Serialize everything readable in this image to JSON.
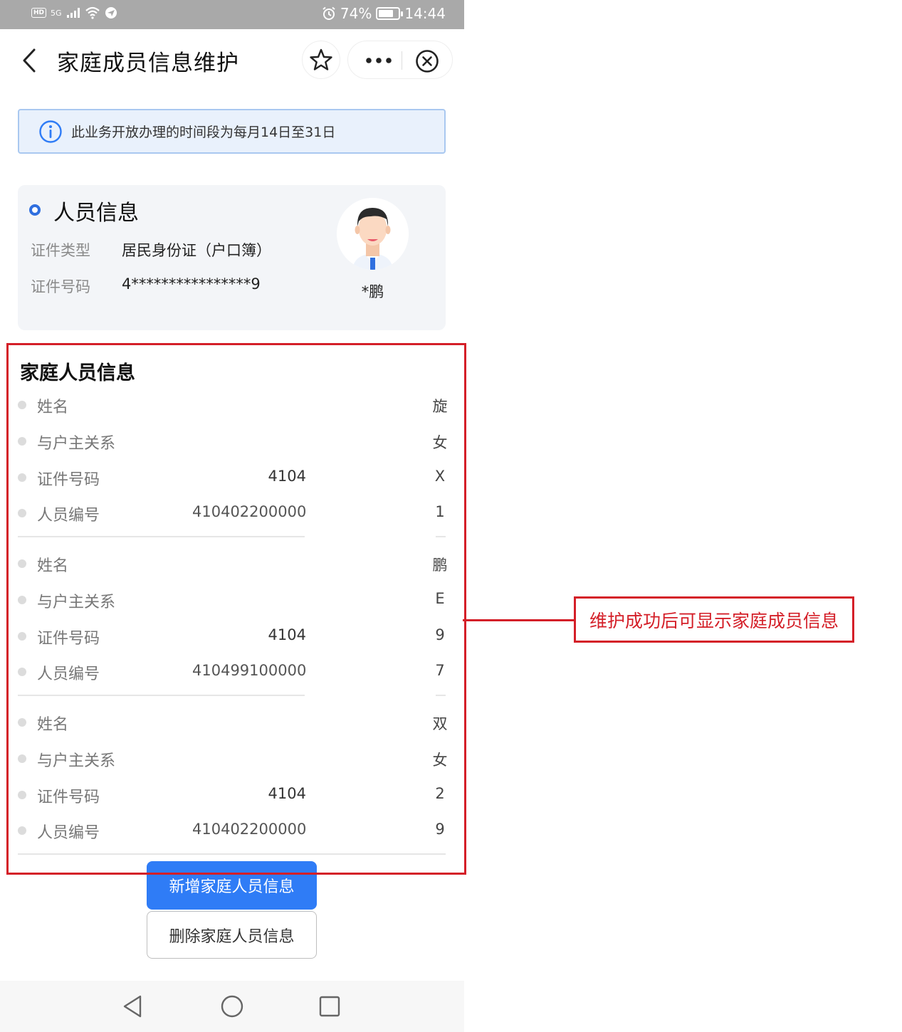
{
  "status_bar": {
    "network": "HD",
    "signal": "5G",
    "battery_text": "74%",
    "battery_level": 0.74,
    "time": "14:44"
  },
  "header": {
    "title": "家庭成员信息维护"
  },
  "notice": {
    "text": "此业务开放办理的时间段为每月14日至31日"
  },
  "person": {
    "section_title": "人员信息",
    "id_type_label": "证件类型",
    "id_type_value": "居民身份证（户口簿）",
    "id_number_label": "证件号码",
    "id_number_value": "4****************9",
    "name": "*鹏"
  },
  "family": {
    "section_title": "家庭人员信息",
    "members": [
      {
        "rows": [
          {
            "label": "姓名",
            "value": "",
            "tail": "旋"
          },
          {
            "label": "与户主关系",
            "value": "",
            "tail": "女"
          },
          {
            "label": "证件号码",
            "value": "4104",
            "tail": "X"
          },
          {
            "label": "人员编号",
            "value": "410402200000",
            "tail": "1"
          }
        ]
      },
      {
        "rows": [
          {
            "label": "姓名",
            "value": "",
            "tail": "鹏"
          },
          {
            "label": "与户主关系",
            "value": "",
            "tail": "E"
          },
          {
            "label": "证件号码",
            "value": "4104",
            "tail": "9"
          },
          {
            "label": "人员编号",
            "value": "410499100000",
            "tail": "7"
          }
        ]
      },
      {
        "rows": [
          {
            "label": "姓名",
            "value": "",
            "tail": "双"
          },
          {
            "label": "与户主关系",
            "value": "",
            "tail": "女"
          },
          {
            "label": "证件号码",
            "value": "4104",
            "tail": "2"
          },
          {
            "label": "人员编号",
            "value": "410402200000",
            "tail": "9"
          }
        ]
      }
    ]
  },
  "buttons": {
    "add": "新增家庭人员信息",
    "delete": "删除家庭人员信息"
  },
  "annotation": {
    "text": "维护成功后可显示家庭成员信息",
    "color": "#d41f28"
  },
  "colors": {
    "primary": "#2f7cf6",
    "status_bar": "#a9a9a9",
    "notice_bg": "#e9f1fc"
  }
}
